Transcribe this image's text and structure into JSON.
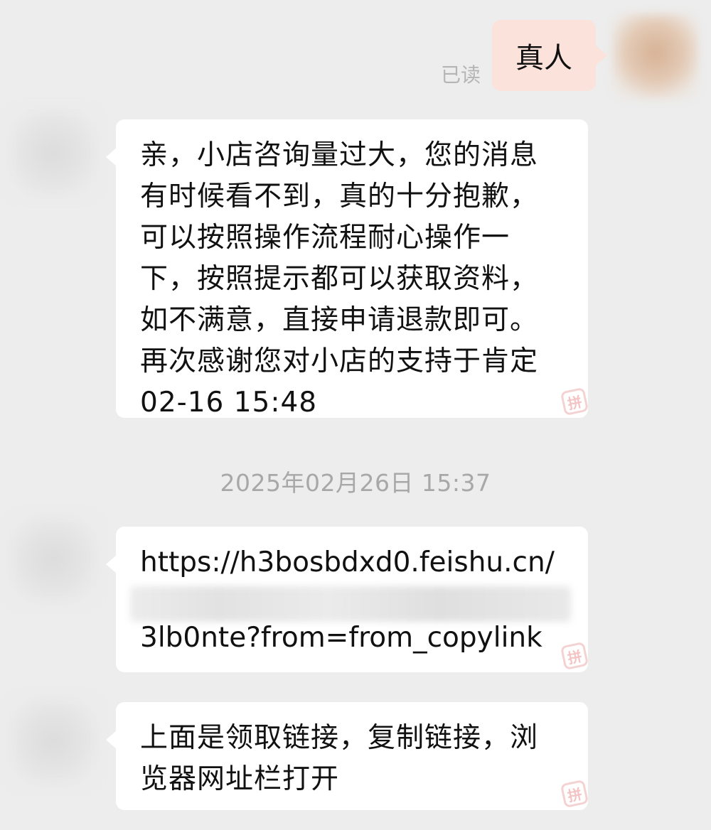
{
  "messages": {
    "outgoing": {
      "text": "真人",
      "status": "已读"
    },
    "incoming1": {
      "text": "亲，小店咨询量过大，您的消息\n有时候看不到，真的十分抱歉，\n可以按照操作流程耐心操作一\n下，按照提示都可以获取资料，\n如不满意，直接申请退款即可。\n再次感谢您对小店的支持于肯定\n02-16 15:48"
    },
    "divider_time": "2025年02月26日 15:37",
    "incoming2": {
      "url_line1": "https://h3bosbdxd0.feishu.cn/",
      "url_line3": "3lb0nte?from=from_copylink"
    },
    "incoming3": {
      "text": "上面是领取链接，复制链接，浏\n览器网址栏打开"
    }
  },
  "icons": {
    "stamp_glyph": "拼"
  },
  "colors": {
    "background": "#ededed",
    "outgoing_bubble": "#fbe3dc",
    "incoming_bubble": "#ffffff",
    "muted_text": "#a8a8a8"
  }
}
